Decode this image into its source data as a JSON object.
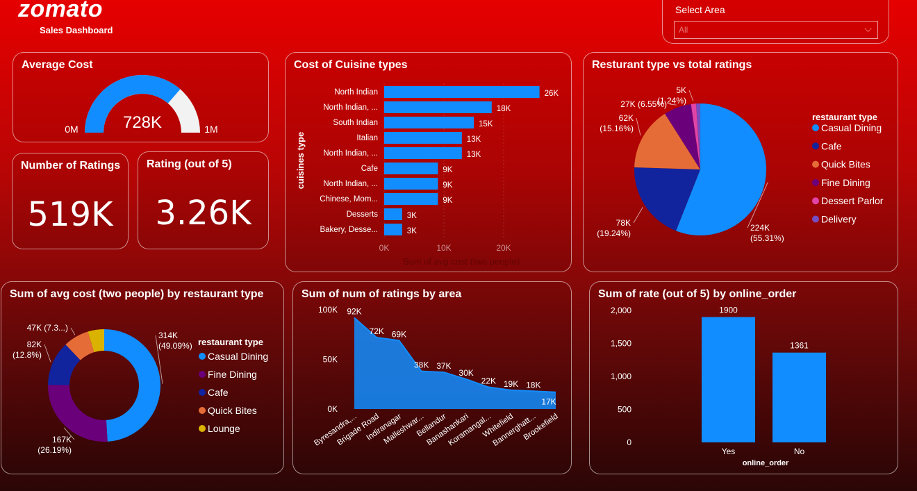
{
  "header": {
    "logo": "zomato",
    "subtitle": "Sales Dashboard"
  },
  "slicer": {
    "title": "Select Area",
    "value": "All"
  },
  "kpis": {
    "number_of_ratings": {
      "title": "Number of Ratings",
      "value": "519K"
    },
    "rating": {
      "title": "Rating (out of 5)",
      "value": "3.26K"
    }
  },
  "colors": {
    "blue": "#118dff",
    "navy": "#12239e",
    "orange": "#e66c37",
    "purple": "#6b007b",
    "pink": "#e044a7",
    "violet": "#744ec2",
    "gold": "#d9b300",
    "track": "#f2f2f2"
  },
  "chart_data": [
    {
      "id": "gauge",
      "type": "gauge",
      "title": "Average Cost",
      "value": 728000,
      "value_label": "728K",
      "min_label": "0M",
      "max_label": "1M",
      "min": 0,
      "max": 1000000
    },
    {
      "id": "cuisine",
      "type": "bar",
      "orientation": "horizontal",
      "title": "Cost of Cuisine types",
      "xlabel": "Sum of avg cost (two people)",
      "ylabel": "cuisines type",
      "categories": [
        "North Indian",
        "North Indian, ...",
        "South Indian",
        "Italian",
        "North Indian, ...",
        "Cafe",
        "North Indian, ...",
        "Chinese, Mom...",
        "Desserts",
        "Bakery, Desse..."
      ],
      "values": [
        26000,
        18000,
        15000,
        13000,
        13000,
        9000,
        9000,
        9000,
        3000,
        3000
      ],
      "labels": [
        "26K",
        "18K",
        "15K",
        "13K",
        "13K",
        "9K",
        "9K",
        "9K",
        "3K",
        "3K"
      ],
      "xticks": [
        "0K",
        "10K",
        "20K"
      ],
      "xlim": [
        0,
        30000
      ]
    },
    {
      "id": "ratings_pie",
      "type": "pie",
      "title": "Resturant type vs total ratings",
      "legend_title": "restaurant type",
      "legend": [
        "Casual Dining",
        "Cafe",
        "Quick Bites",
        "Fine Dining",
        "Dessert Parlor",
        "Delivery"
      ],
      "values": [
        224000,
        78000,
        62000,
        27000,
        5000,
        4000
      ],
      "labels": [
        [
          "224K",
          "(55.31%)"
        ],
        [
          "78K",
          "(19.24%)"
        ],
        [
          "62K",
          "(15.16%)"
        ],
        [
          "27K (6.55%)"
        ],
        [
          "5K",
          "(1.24%)"
        ],
        []
      ]
    },
    {
      "id": "cost_donut",
      "type": "donut",
      "title": "Sum of avg cost (two people) by restaurant type",
      "legend_title": "restaurant type",
      "legend": [
        "Casual Dining",
        "Fine Dining",
        "Cafe",
        "Quick Bites",
        "Lounge"
      ],
      "values": [
        314000,
        167000,
        82000,
        47000,
        30000
      ],
      "labels": [
        [
          "314K",
          "(49.09%)"
        ],
        [
          "167K",
          "(26.19%)"
        ],
        [
          "82K",
          "(12.8%)"
        ],
        [
          "47K (7.3...)"
        ],
        []
      ]
    },
    {
      "id": "area",
      "type": "area",
      "title": "Sum of num of ratings by area",
      "categories": [
        "Byresandra,...",
        "Brigade Road",
        "Indiranagar",
        "Malleshwar...",
        "Bellandur",
        "Banashankari",
        "Koramangal...",
        "Whitefield",
        "Bannerghatt...",
        "Brookefield"
      ],
      "values": [
        92000,
        72000,
        69000,
        38000,
        37000,
        30000,
        22000,
        19000,
        18000,
        17000
      ],
      "labels": [
        "92K",
        "72K",
        "69K",
        "38K",
        "37K",
        "30K",
        "22K",
        "19K",
        "18K",
        "17K"
      ],
      "yticks": [
        "0K",
        "50K",
        "100K"
      ],
      "ylim": [
        0,
        100000
      ]
    },
    {
      "id": "online_order",
      "type": "bar",
      "title": "Sum of rate (out of 5) by online_order",
      "xlabel": "online_order",
      "categories": [
        "Yes",
        "No"
      ],
      "values": [
        1900,
        1361
      ],
      "labels": [
        "1900",
        "1361"
      ],
      "yticks": [
        "0",
        "500",
        "1,000",
        "1,500",
        "2,000"
      ],
      "ylim": [
        0,
        2000
      ]
    }
  ]
}
